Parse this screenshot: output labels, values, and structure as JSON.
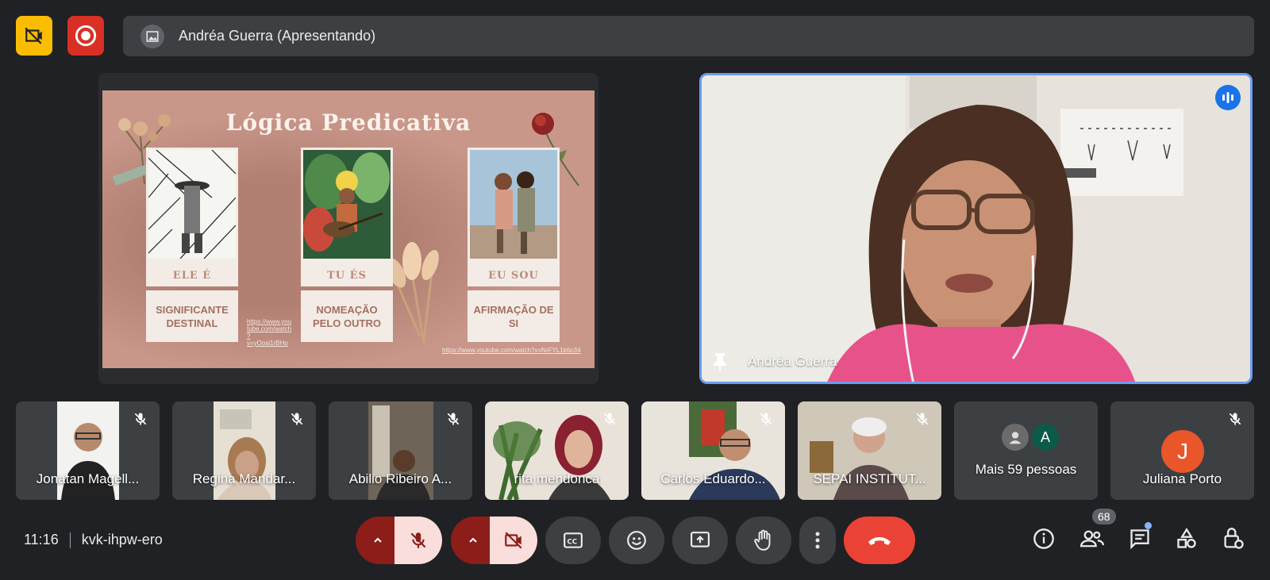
{
  "top_bar": {
    "presenter_label": "Andréa Guerra (Apresentando)"
  },
  "slide": {
    "title": "Lógica Predicativa",
    "cards": [
      {
        "caption": "ELE É",
        "label": "SIGNIFICANTE DESTINAL"
      },
      {
        "caption": "TU ÉS",
        "label": "NOMEAÇÃO PELO OUTRO"
      },
      {
        "caption": "EU SOU",
        "label": "AFIRMAÇÃO DE SI"
      }
    ],
    "link_small": "https://www.you tube.com/watch ?v=yOosi1rBHo",
    "link_bottom": "https://www.youtube.com/watch?v=NrFYL1k6o34"
  },
  "speaker": {
    "name": "Andréa Guerra"
  },
  "participants": [
    {
      "name": "Jonatan Magell..."
    },
    {
      "name": "Regina Mandar..."
    },
    {
      "name": "Abilio Ribeiro A..."
    },
    {
      "name": "rita mendonca"
    },
    {
      "name": "Carlos Eduardo..."
    },
    {
      "name": "SEPAI INSTITUT..."
    },
    {
      "name": "Mais 59 pessoas",
      "avatar_letter": "A"
    },
    {
      "name": "Juliana Porto",
      "avatar_letter": "J"
    }
  ],
  "bottom_bar": {
    "time": "11:16",
    "meeting_code": "kvk-ihpw-ero",
    "people_count": "68"
  },
  "colors": {
    "background": "#202124",
    "tile": "#3c4043",
    "leave": "#ea4335",
    "active_speaker_border": "#6a9cf0",
    "recording": "#d93025",
    "rec_off_badge": "#fbbc04"
  },
  "icons": [
    "no-recording-icon",
    "record-icon",
    "mic-off-icon",
    "camera-off-icon",
    "captions-icon",
    "emoji-icon",
    "present-icon",
    "raise-hand-icon",
    "more-options-icon",
    "leave-call-icon",
    "info-icon",
    "people-icon",
    "chat-icon",
    "activities-icon",
    "host-controls-icon",
    "pin-icon",
    "audio-level-icon"
  ]
}
